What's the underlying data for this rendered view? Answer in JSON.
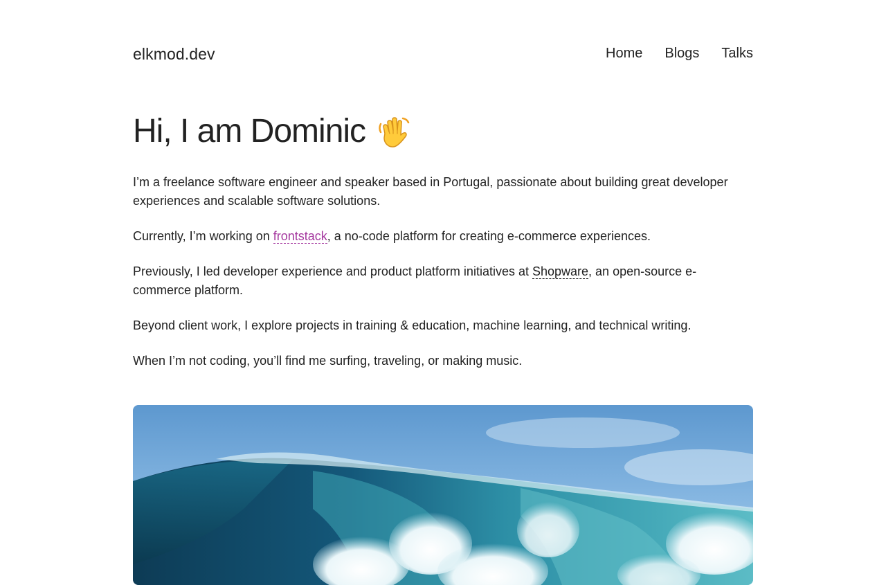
{
  "site": {
    "logo": "elkmod.dev"
  },
  "nav": {
    "items": [
      {
        "label": "Home"
      },
      {
        "label": "Blogs"
      },
      {
        "label": "Talks"
      }
    ]
  },
  "intro": {
    "title": "Hi, I am Dominic",
    "emoji": "waving-hand-icon"
  },
  "bio": {
    "p1": "I’m a freelance software engineer and speaker based in Portugal, passionate about building great developer experiences and scalable software solutions.",
    "p2_before": "Currently, I’m working on ",
    "p2_link": "frontstack",
    "p2_after": ", a no-code platform for creating e-commerce experiences.",
    "p3_before": "Previously, I led developer experience and product platform initiatives at ",
    "p3_link": "Shopware",
    "p3_after": ", an open-source e-commerce platform.",
    "p4": "Beyond client work, I explore projects in training & education, machine learning, and technical writing.",
    "p5": "When I’m not coding, you’ll find me surfing, traveling, or making music."
  },
  "hero_image": {
    "subject": "ocean-wave-photo"
  },
  "colors": {
    "accent_link": "#a4369e",
    "text": "#222222",
    "background": "#ffffff"
  }
}
